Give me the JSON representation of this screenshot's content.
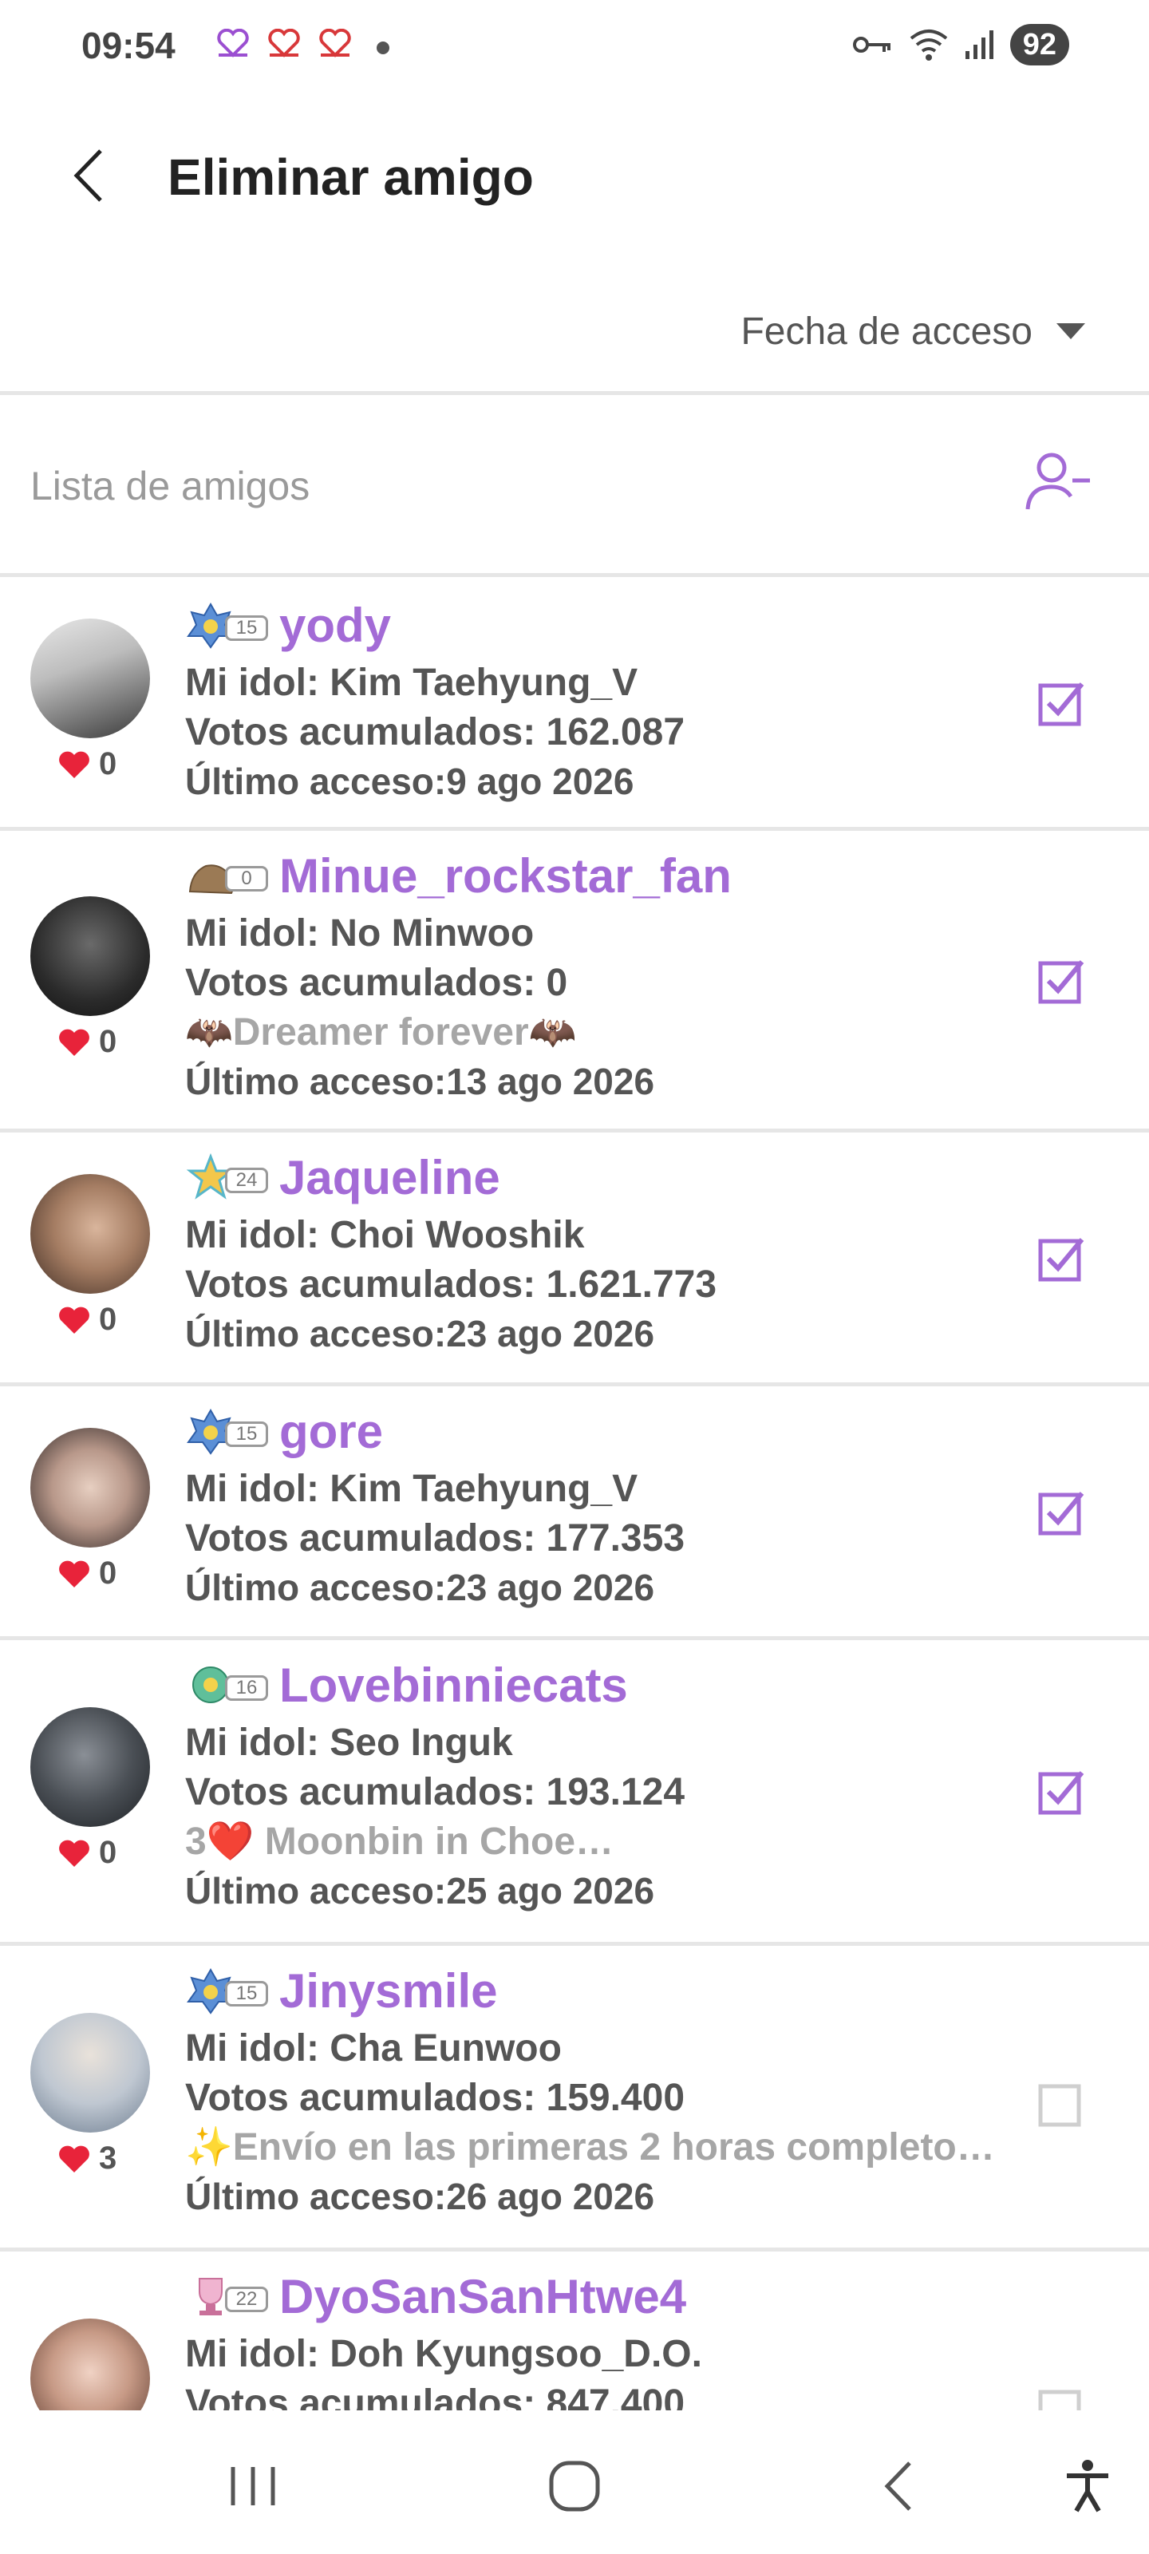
{
  "status_bar": {
    "time": "09:54",
    "battery": "92",
    "icons": [
      "heart-notification-icon",
      "heart-notification-icon",
      "heart-notification-icon",
      "key-icon",
      "wifi-icon",
      "signal-icon"
    ]
  },
  "header": {
    "title": "Eliminar amigo"
  },
  "sort": {
    "label": "Fecha de acceso"
  },
  "list": {
    "label": "Lista de amigos"
  },
  "friends": [
    {
      "name": "yody",
      "level": "15",
      "idol": "Mi idol: Kim Taehyung_V",
      "votes": "Votos acumulados: 162.087",
      "status": "",
      "last_access": "Último acceso:9 ago 2026",
      "likes": "0",
      "checked": true
    },
    {
      "name": "Minue_rockstar_fan",
      "level": "0",
      "idol": "Mi idol: No Minwoo",
      "votes": "Votos acumulados: 0",
      "status": "🦇Dreamer forever🦇",
      "last_access": "Último acceso:13 ago 2026",
      "likes": "0",
      "checked": true
    },
    {
      "name": "Jaqueline",
      "level": "24",
      "idol": "Mi idol: Choi Wooshik",
      "votes": "Votos acumulados: 1.621.773",
      "status": "",
      "last_access": "Último acceso:23 ago 2026",
      "likes": "0",
      "checked": true
    },
    {
      "name": "gore",
      "level": "15",
      "idol": "Mi idol: Kim Taehyung_V",
      "votes": "Votos acumulados: 177.353",
      "status": "",
      "last_access": "Último acceso:23 ago 2026",
      "likes": "0",
      "checked": true
    },
    {
      "name": "Lovebinniecats",
      "level": "16",
      "idol": "Mi idol: Seo Inguk",
      "votes": "Votos acumulados: 193.124",
      "status": "3❤️ Moonbin in Choe…",
      "last_access": "Último acceso:25 ago 2026",
      "likes": "0",
      "checked": true
    },
    {
      "name": "Jinysmile",
      "level": "15",
      "idol": "Mi idol: Cha Eunwoo",
      "votes": "Votos acumulados: 159.400",
      "status": "✨Envío en las primeras 2 horas completo…",
      "last_access": "Último acceso:26 ago 2026",
      "likes": "3",
      "checked": false
    },
    {
      "name": "DyoSanSanHtwe4",
      "level": "22",
      "idol": "Mi idol: Doh Kyungsoo_D.O.",
      "votes": "Votos acumulados: 847.400",
      "status": "",
      "last_access": "",
      "likes": "",
      "checked": false
    }
  ],
  "colors": {
    "accent": "#a36bd6",
    "heart": "#e8233a",
    "text": "#555555",
    "muted": "#a6a6a6"
  }
}
